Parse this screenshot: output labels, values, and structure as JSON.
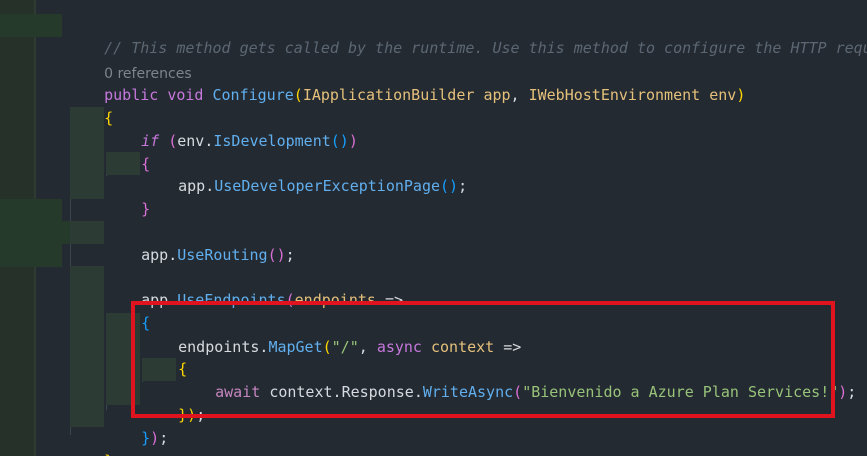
{
  "code": {
    "comment": "// This method gets called by the runtime. Use this method to configure the HTTP request pipeline.",
    "codelens": "0 references",
    "signature": {
      "public": "public",
      "void": "void",
      "method": "Configure",
      "open": "(",
      "param1_type": "IApplicationBuilder",
      "param1_name": "app",
      "comma": ",",
      "param2_type": "IWebHostEnvironment",
      "param2_name": "env",
      "close": ")"
    },
    "open_brace": "{",
    "if_kw": "if",
    "if_open": "(",
    "env": "env",
    "dot": ".",
    "is_dev": "IsDevelopment",
    "call_parens": "()",
    "if_close": ")",
    "inner_open": "{",
    "app": "app",
    "use_dev": "UseDeveloperExceptionPage",
    "semicolon": ";",
    "inner_close": "}",
    "use_routing": "UseRouting",
    "use_endpoints": "UseEndpoints",
    "endpoints_param": "endpoints",
    "arrow": "=>",
    "lambda_open": "{",
    "endpoints": "endpoints",
    "map_get": "MapGet",
    "route": "\"/\"",
    "async_kw": "async",
    "context": "context",
    "handler_open": "{",
    "await_kw": "await",
    "response": "Response",
    "write_async": "WriteAsync",
    "message": "\"Bienvenido a Azure Plan Services!\"",
    "handler_close": "}",
    "lambda_close": "}",
    "method_close": "}"
  },
  "colors": {
    "background": "#232a31",
    "highlight_border": "#e0141e",
    "comment": "#5c6773",
    "keyword": "#c678dd",
    "function": "#61afef",
    "type": "#e5c07b",
    "string": "#98c379"
  }
}
